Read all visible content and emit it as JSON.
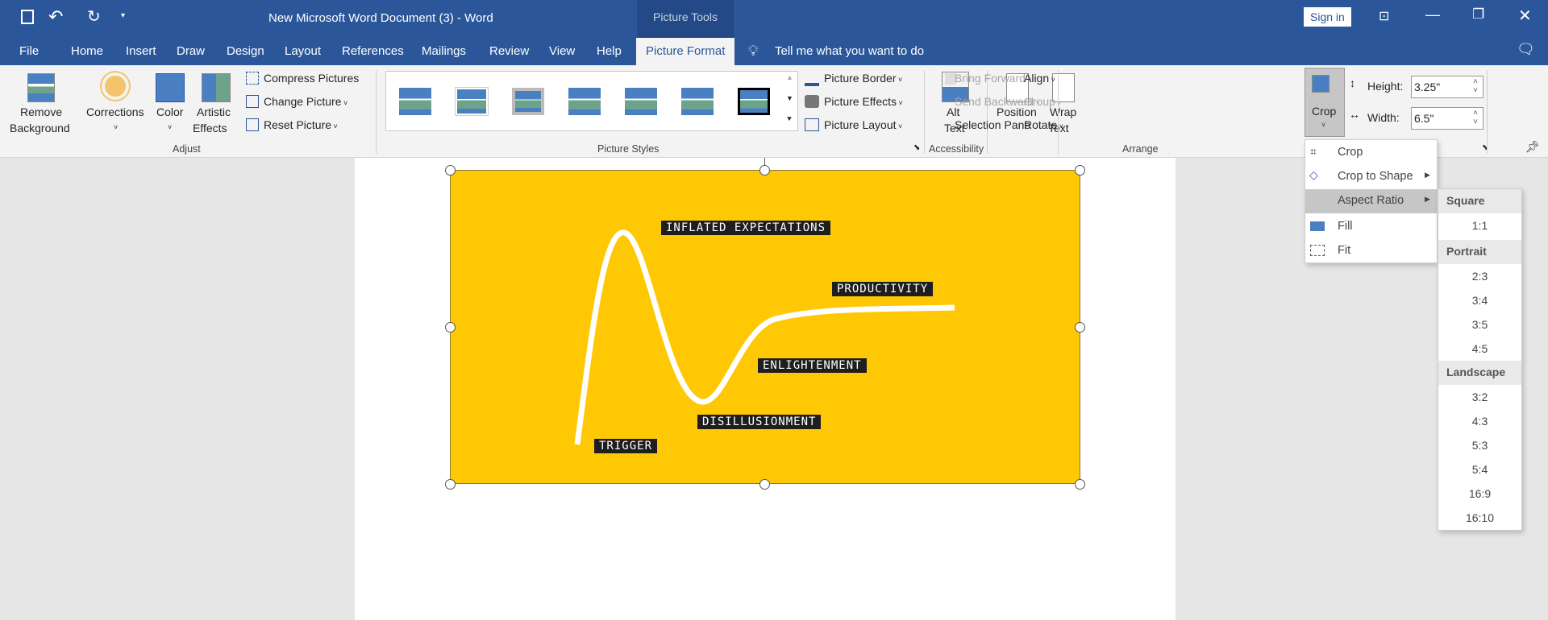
{
  "window": {
    "title": "New Microsoft Word Document (3)  -  Word",
    "context_tab_group": "Picture Tools",
    "sign_in": "Sign in"
  },
  "tabs": [
    "File",
    "Home",
    "Insert",
    "Draw",
    "Design",
    "Layout",
    "References",
    "Mailings",
    "Review",
    "View",
    "Help",
    "Picture Format"
  ],
  "active_tab": "Picture Format",
  "tell_me": "Tell me what you want to do",
  "ribbon": {
    "adjust": {
      "remove_bg_1": "Remove",
      "remove_bg_2": "Background",
      "corrections": "Corrections",
      "color": "Color",
      "artistic_1": "Artistic",
      "artistic_2": "Effects",
      "compress": "Compress Pictures",
      "change": "Change Picture",
      "reset": "Reset Picture",
      "group": "Adjust"
    },
    "styles": {
      "border": "Picture Border",
      "effects": "Picture Effects",
      "layout": "Picture Layout",
      "group": "Picture Styles"
    },
    "accessibility": {
      "alt_1": "Alt",
      "alt_2": "Text",
      "group": "Accessibility"
    },
    "arrange": {
      "position": "Position",
      "wrap_1": "Wrap",
      "wrap_2": "Text",
      "bring_forward": "Bring Forward",
      "send_backward": "Send Backward",
      "selection_pane": "Selection Pane",
      "align": "Align",
      "group_btn": "Group",
      "rotate": "Rotate",
      "group": "Arrange"
    },
    "size": {
      "crop": "Crop",
      "height_label": "Height:",
      "height": "3.25\"",
      "width_label": "Width:",
      "width": "6.5\""
    }
  },
  "picture": {
    "labels": {
      "inflated": "INFLATED EXPECTATIONS",
      "productivity": "PRODUCTIVITY",
      "enlightenment": "ENLIGHTENMENT",
      "disillusionment": "DISILLUSIONMENT",
      "trigger": "TRIGGER"
    },
    "bg_color": "#ffc805"
  },
  "crop_menu": {
    "items": [
      "Crop",
      "Crop to Shape",
      "Aspect Ratio",
      "Fill",
      "Fit"
    ],
    "selected": "Aspect Ratio"
  },
  "aspect_menu": {
    "square": "Square",
    "square_items": [
      "1:1"
    ],
    "portrait": "Portrait",
    "portrait_items": [
      "2:3",
      "3:4",
      "3:5",
      "4:5"
    ],
    "landscape": "Landscape",
    "landscape_items": [
      "3:2",
      "4:3",
      "5:3",
      "5:4",
      "16:9",
      "16:10"
    ]
  },
  "colors": {
    "accent": "#2b579a"
  }
}
